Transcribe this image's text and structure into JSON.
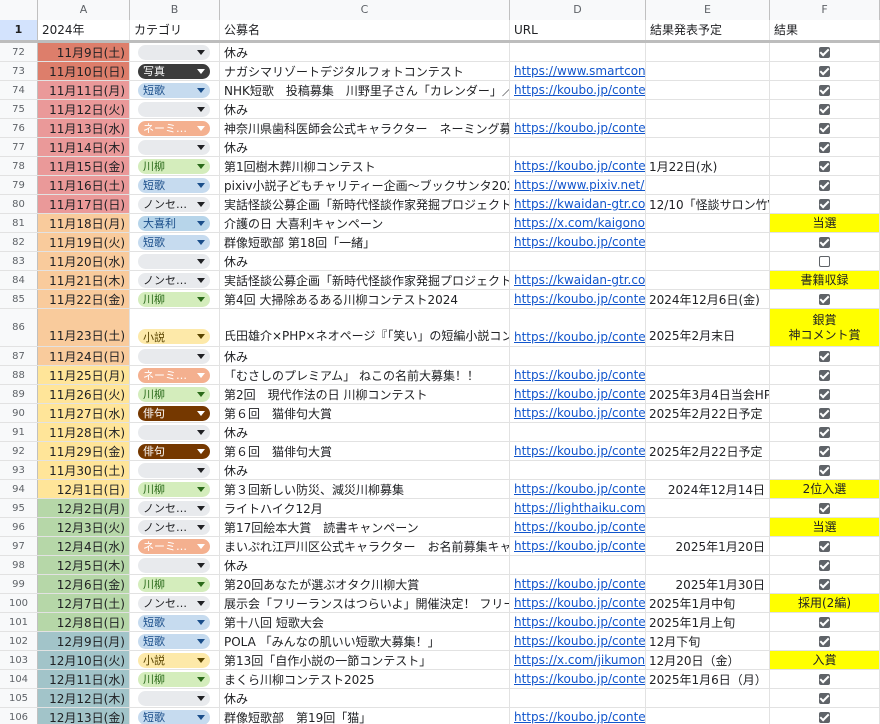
{
  "columns": [
    "A",
    "B",
    "C",
    "D",
    "E",
    "F"
  ],
  "header": {
    "row_number": "1",
    "a": "2024年",
    "b": "カテゴリ",
    "c": "公募名",
    "d": "URL",
    "e": "結果発表予定",
    "f": "結果"
  },
  "colors": {
    "date_red": "#dd7e6b",
    "date_pink": "#ea9999",
    "date_orange": "#f9cb9c",
    "date_yellow": "#ffe599",
    "date_green": "#b6d7a8",
    "date_teal": "#a2c4c9",
    "result_yellow": "#ffff00"
  },
  "chip_styles": {
    "写真": {
      "bg": "#3c3c3c",
      "fg": "#ffffff"
    },
    "短歌": {
      "bg": "#c6dbef",
      "fg": "#1a4e8a"
    },
    "ネーミ…": {
      "bg": "#f4b08f",
      "fg": "#ffffff"
    },
    "川柳": {
      "bg": "#d4edbc",
      "fg": "#2a6a1a"
    },
    "ノンセ…": {
      "bg": "#e8eaed",
      "fg": "#202124"
    },
    "大喜利": {
      "bg": "#b7d5ea",
      "fg": "#1a4e8a"
    },
    "小説": {
      "bg": "#fde9a9",
      "fg": "#5a4500"
    },
    "俳句": {
      "bg": "#753800",
      "fg": "#ffffff"
    },
    "": {
      "bg": "#e8eaed",
      "fg": "#202124"
    }
  },
  "rows": [
    {
      "n": "72",
      "date": "11月9日(土)",
      "cat": "",
      "title": "休み",
      "url": "",
      "release": "",
      "result": "checked",
      "color": "date_red"
    },
    {
      "n": "73",
      "date": "11月10日(日)",
      "cat": "写真",
      "title": "ナガシマリゾートデジタルフォトコンテスト",
      "url": "https://www.smartcontest",
      "release": "",
      "result": "checked",
      "color": "date_red"
    },
    {
      "n": "74",
      "date": "11月11日(月)",
      "cat": "短歌",
      "title": "NHK短歌　投稿募集　川野里子さん「カレンダー」／",
      "url": "https://koubo.jp/contest/2",
      "release": "",
      "result": "checked",
      "color": "date_pink"
    },
    {
      "n": "75",
      "date": "11月12日(火)",
      "cat": "",
      "title": "休み",
      "url": "",
      "release": "",
      "result": "checked",
      "color": "date_pink"
    },
    {
      "n": "76",
      "date": "11月13日(水)",
      "cat": "ネーミ…",
      "title": "神奈川県歯科医師会公式キャラクター　ネーミング募",
      "url": "https://koubo.jp/contest/2",
      "release": "",
      "result": "checked",
      "color": "date_pink"
    },
    {
      "n": "77",
      "date": "11月14日(木)",
      "cat": "",
      "title": "休み",
      "url": "",
      "release": "",
      "result": "checked",
      "color": "date_pink"
    },
    {
      "n": "78",
      "date": "11月15日(金)",
      "cat": "川柳",
      "title": "第1回樹木葬川柳コンテスト",
      "url": "https://koubo.jp/contest/2",
      "release": "1月22日(水)",
      "result": "checked",
      "color": "date_pink"
    },
    {
      "n": "79",
      "date": "11月16日(土)",
      "cat": "短歌",
      "title": "pixiv小説子どもチャリティー企画〜ブックサンタ202",
      "url": "https://www.pixiv.net/nove",
      "release": "",
      "result": "checked",
      "color": "date_pink"
    },
    {
      "n": "80",
      "date": "11月17日(日)",
      "cat": "ノンセ…",
      "title": "実話怪談公募企画「新時代怪談作家発掘プロジェクト",
      "url": "https://kwaidan-gtr.com/m",
      "release": "12/10「怪談サロン竹V",
      "result": "checked",
      "color": "date_pink"
    },
    {
      "n": "81",
      "date": "11月18日(月)",
      "cat": "大喜利",
      "title": "介護の日 大喜利キャンペーン",
      "url": "https://x.com/kaigonomira",
      "release": "",
      "result": "当選",
      "color": "date_orange"
    },
    {
      "n": "82",
      "date": "11月19日(火)",
      "cat": "短歌",
      "title": "群像短歌部 第18回「一緒」",
      "url": "https://koubo.jp/contest/2",
      "release": "",
      "result": "checked",
      "color": "date_orange"
    },
    {
      "n": "83",
      "date": "11月20日(水)",
      "cat": "",
      "title": "休み",
      "url": "",
      "release": "",
      "result": "unchecked",
      "color": "date_orange"
    },
    {
      "n": "84",
      "date": "11月21日(木)",
      "cat": "ノンセ…",
      "title": "実話怪談公募企画「新時代怪談作家発掘プロジェクト",
      "url": "https://kwaidan-gtr.com/m",
      "release": "",
      "result": "書籍収録",
      "color": "date_orange"
    },
    {
      "n": "85",
      "date": "11月22日(金)",
      "cat": "川柳",
      "title": "第4回 大掃除あるある川柳コンテスト2024",
      "url": "https://koubo.jp/contest/2",
      "release": "2024年12月6日(金)",
      "result": "checked",
      "color": "date_orange"
    },
    {
      "n": "86",
      "date": "11月23日(土)",
      "cat": "小説",
      "title": "氏田雄介×PHP×ネオページ『「笑い」の短編小説コン",
      "url": "https://koubo.jp/contest/2",
      "release": "2025年2月末日",
      "result": "銀賞\n神コメント賞",
      "tall": true,
      "color": "date_orange"
    },
    {
      "n": "87",
      "date": "11月24日(日)",
      "cat": "",
      "title": "休み",
      "url": "",
      "release": "",
      "result": "checked",
      "color": "date_orange"
    },
    {
      "n": "88",
      "date": "11月25日(月)",
      "cat": "ネーミ…",
      "title": "「むさしのプレミアム」 ねこの名前大募集！！",
      "url": "https://koubo.jp/contest/2",
      "release": "",
      "result": "checked",
      "color": "date_yellow"
    },
    {
      "n": "89",
      "date": "11月26日(火)",
      "cat": "川柳",
      "title": "第2回　現代作法の日 川柳コンテスト",
      "url": "https://koubo.jp/contest/2",
      "release": "2025年3月4日当会HP",
      "result": "checked",
      "color": "date_yellow"
    },
    {
      "n": "90",
      "date": "11月27日(水)",
      "cat": "俳句",
      "title": "第６回　猫俳句大賞",
      "url": "https://koubo.jp/contest/2",
      "release": "2025年2月22日予定",
      "result": "checked",
      "color": "date_yellow"
    },
    {
      "n": "91",
      "date": "11月28日(木)",
      "cat": "",
      "title": "休み",
      "url": "",
      "release": "",
      "result": "checked",
      "color": "date_yellow"
    },
    {
      "n": "92",
      "date": "11月29日(金)",
      "cat": "俳句",
      "title": "第６回　猫俳句大賞",
      "url": "https://koubo.jp/contest/2",
      "release": "2025年2月22日予定",
      "result": "checked",
      "color": "date_yellow"
    },
    {
      "n": "93",
      "date": "11月30日(土)",
      "cat": "",
      "title": "休み",
      "url": "",
      "release": "",
      "result": "checked",
      "color": "date_yellow"
    },
    {
      "n": "94",
      "date": "12月1日(日)",
      "cat": "川柳",
      "title": "第３回新しい防災、減災川柳募集",
      "url": "https://koubo.jp/contest/2",
      "release": "2024年12月14日",
      "release_right": true,
      "result": "2位入選",
      "color": "date_yellow"
    },
    {
      "n": "95",
      "date": "12月2日(月)",
      "cat": "ノンセ…",
      "title": "ライトハイク12月",
      "url": "https://lighthaiku.com/oda",
      "release": "",
      "result": "checked",
      "color": "date_green"
    },
    {
      "n": "96",
      "date": "12月3日(火)",
      "cat": "ノンセ…",
      "title": "第17回絵本大賞　読書キャンペーン",
      "url": "https://koubo.jp/contest/2",
      "release": "",
      "result": "当選",
      "color": "date_green"
    },
    {
      "n": "97",
      "date": "12月4日(水)",
      "cat": "ネーミ…",
      "title": "まいぷれ江戸川区公式キャラクター　お名前募集キャ",
      "url": "https://koubo.jp/contest/2",
      "release": "2025年1月20日",
      "release_right": true,
      "result": "checked",
      "color": "date_green"
    },
    {
      "n": "98",
      "date": "12月5日(木)",
      "cat": "",
      "title": "休み",
      "url": "",
      "release": "",
      "result": "checked",
      "color": "date_green"
    },
    {
      "n": "99",
      "date": "12月6日(金)",
      "cat": "川柳",
      "title": "第20回あなたが選ぶオタク川柳大賞",
      "url": "https://koubo.jp/contest/2",
      "release": "2025年1月30日",
      "release_right": true,
      "result": "checked",
      "color": "date_green"
    },
    {
      "n": "100",
      "date": "12月7日(土)",
      "cat": "ノンセ…",
      "title": "展示会「フリーランスはつらいよ」開催決定！ フリー",
      "url": "https://koubo.jp/contest/2",
      "release": "2025年1月中旬",
      "result": "採用(2編)",
      "color": "date_green"
    },
    {
      "n": "101",
      "date": "12月8日(日)",
      "cat": "短歌",
      "title": "第十八回 短歌大会",
      "url": "https://koubo.jp/contest/2",
      "release": "2025年1月上旬",
      "result": "checked",
      "color": "date_green"
    },
    {
      "n": "102",
      "date": "12月9日(月)",
      "cat": "短歌",
      "title": "POLA 「みんなの肌いい短歌大募集！」",
      "url": "https://koubo.jp/contest/2",
      "release": "12月下旬",
      "result": "checked",
      "color": "date_teal"
    },
    {
      "n": "103",
      "date": "12月10日(火)",
      "cat": "小説",
      "title": "第13回「自作小説の一節コンテスト」",
      "url": "https://x.com/jikumonoga",
      "release": "12月20日（金）",
      "result": "入賞",
      "color": "date_teal"
    },
    {
      "n": "104",
      "date": "12月11日(水)",
      "cat": "川柳",
      "title": "まくら川柳コンテスト2025",
      "url": "https://koubo.jp/contest/2",
      "release": "2025年1月6日（月）",
      "result": "checked",
      "color": "date_teal"
    },
    {
      "n": "105",
      "date": "12月12日(木)",
      "cat": "",
      "title": "休み",
      "url": "",
      "release": "",
      "result": "checked",
      "color": "date_teal"
    },
    {
      "n": "106",
      "date": "12月13日(金)",
      "cat": "短歌",
      "title": "群像短歌部　第19回「猫」",
      "url": "https://koubo.jp/contest/2",
      "release": "",
      "result": "checked",
      "color": "date_teal"
    }
  ]
}
